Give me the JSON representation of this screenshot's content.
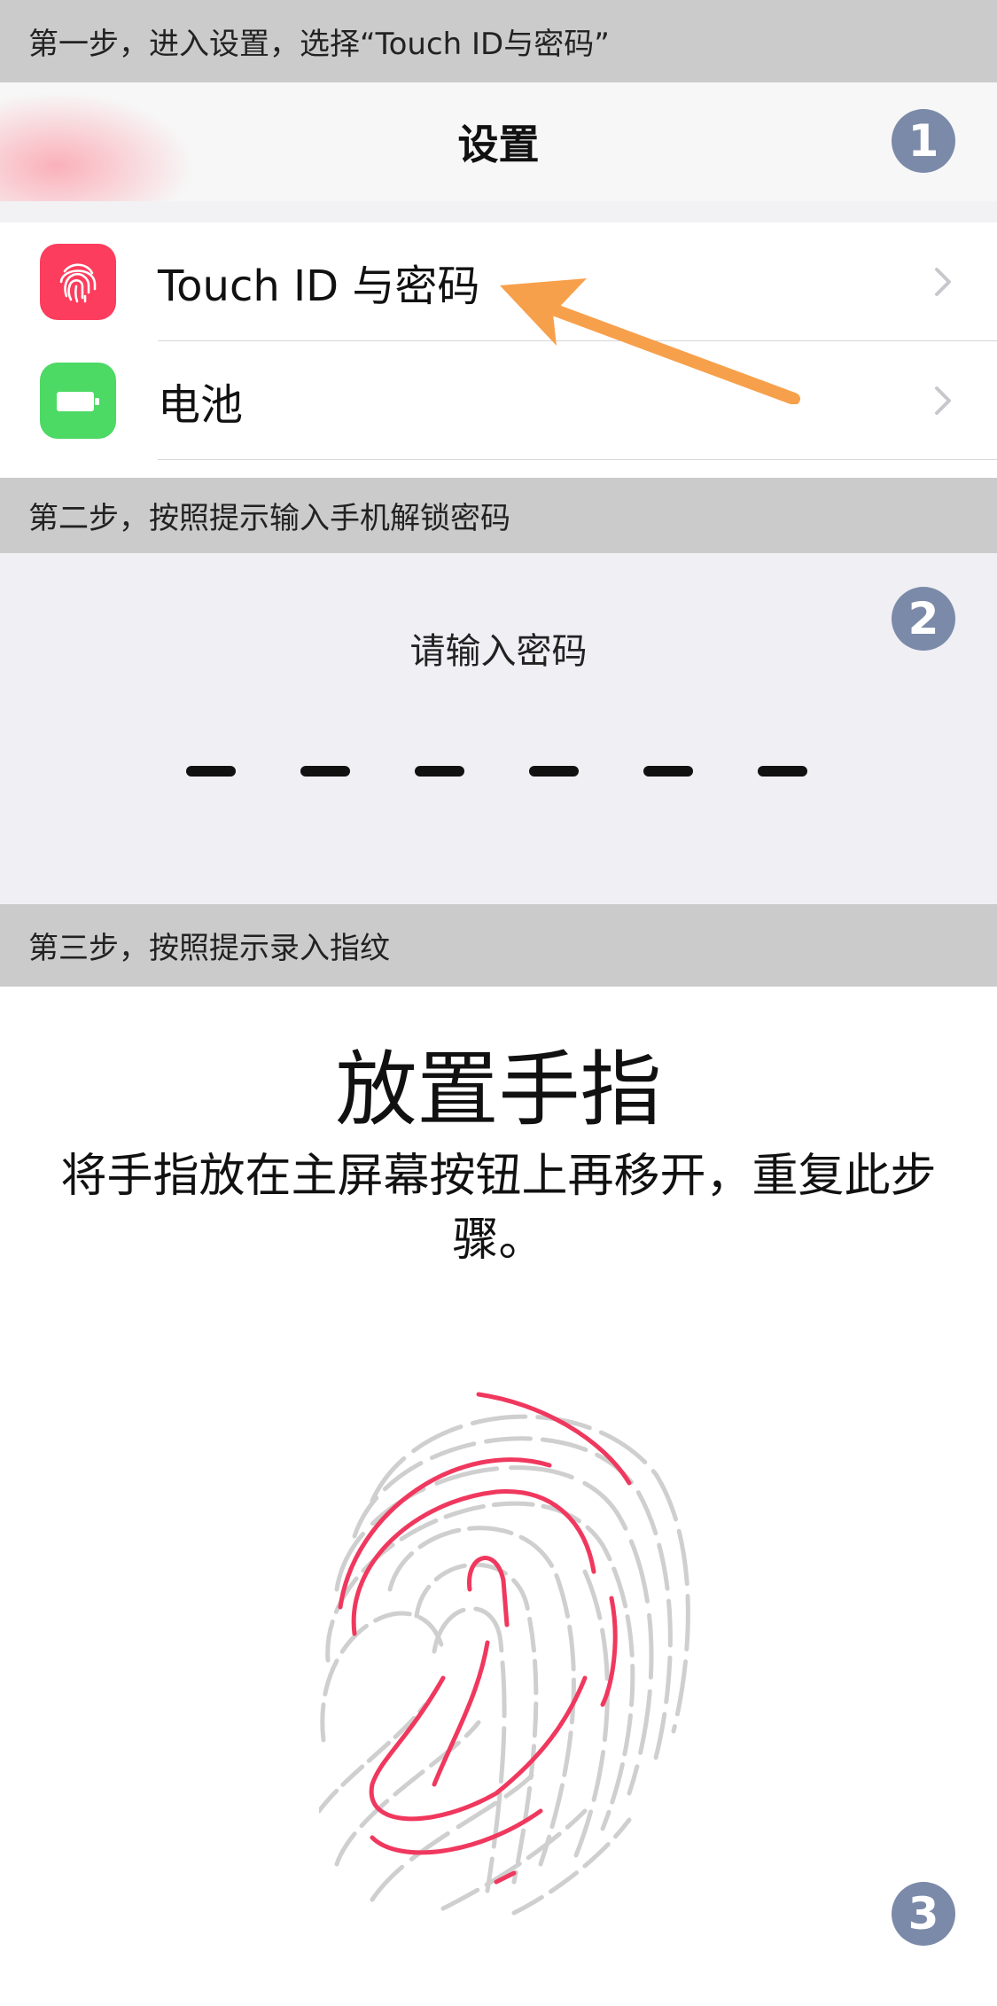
{
  "step1": {
    "text": "第一步，进入设置，选择“Touch ID与密码”",
    "badge": "1"
  },
  "settings": {
    "title": "设置",
    "items": [
      {
        "label": "Touch ID 与密码",
        "icon": "fingerprint-icon",
        "icon_color": "#fc3d5d"
      },
      {
        "label": "电池",
        "icon": "battery-icon",
        "icon_color": "#4cd964"
      }
    ]
  },
  "step2": {
    "text": "第二步，按照提示输入手机解锁密码",
    "badge": "2"
  },
  "passcode": {
    "prompt": "请输入密码",
    "digits": 6
  },
  "step3": {
    "text": "第三步，按照提示录入指纹",
    "badge": "3"
  },
  "enroll": {
    "heading": "放置手指",
    "instruction": "将手指放在主屏幕按钮上再移开，重复此步骤。"
  },
  "colors": {
    "accent": "#ff2d55",
    "arrow": "#f7a04b",
    "badge": "#7b8aa8"
  }
}
